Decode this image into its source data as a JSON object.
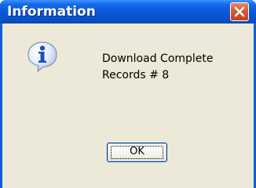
{
  "window": {
    "title": "Information",
    "close_icon": "close-icon"
  },
  "dialog": {
    "icon": "information-icon",
    "message_line1": "Download Complete",
    "message_line2": "Records # 8"
  },
  "buttons": {
    "ok_label": "OK"
  },
  "colors": {
    "titlebar": "#0a58d6",
    "close_button": "#d65a36",
    "dialog_background": "#ece9d8"
  }
}
